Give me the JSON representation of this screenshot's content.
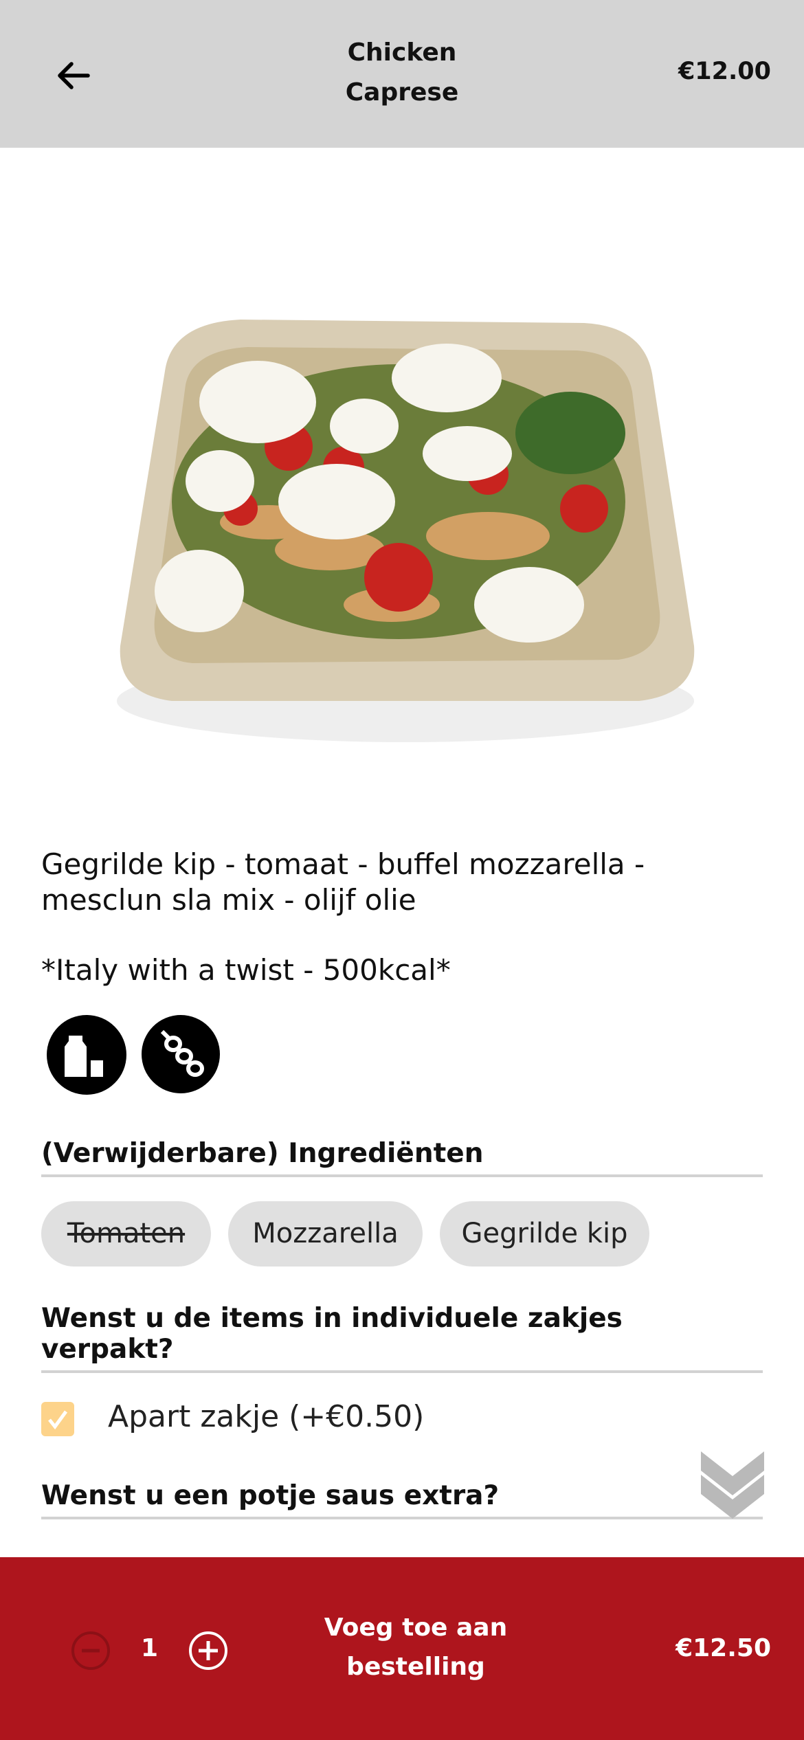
{
  "header": {
    "title_line1": "Chicken",
    "title_line2": "Caprese",
    "price": "€12.00",
    "back_icon": "arrow-left-icon"
  },
  "description": {
    "line1": "Gegrilde kip - tomaat - buffel mozzarella -",
    "line2": "mesclun sla mix - olijf olie",
    "tagline": "*Italy with a twist - 500kcal*"
  },
  "allergens": [
    {
      "icon": "milk-allergen-icon"
    },
    {
      "icon": "soy-allergen-icon"
    }
  ],
  "ingredients": {
    "heading": "(Verwijderbare) Ingrediënten",
    "items": [
      {
        "label": "Tomaten",
        "removed": true
      },
      {
        "label": "Mozzarella",
        "removed": false
      },
      {
        "label": "Gegrilde kip",
        "removed": false
      }
    ]
  },
  "packaging": {
    "heading": "Wenst u de items in individuele zakjes verpakt?",
    "option_label": "Apart zakje (+€0.50)",
    "checked": true
  },
  "sauce": {
    "heading": "Wenst u een potje saus extra?"
  },
  "footer": {
    "quantity": "1",
    "add_line1": "Voeg toe aan",
    "add_line2": "bestelling",
    "total": "€12.50"
  },
  "colors": {
    "header_bg": "#d4d4d4",
    "footer_bg": "#ae151d",
    "checkbox": "#fdd38a",
    "chip_bg": "#e0e0e0"
  }
}
